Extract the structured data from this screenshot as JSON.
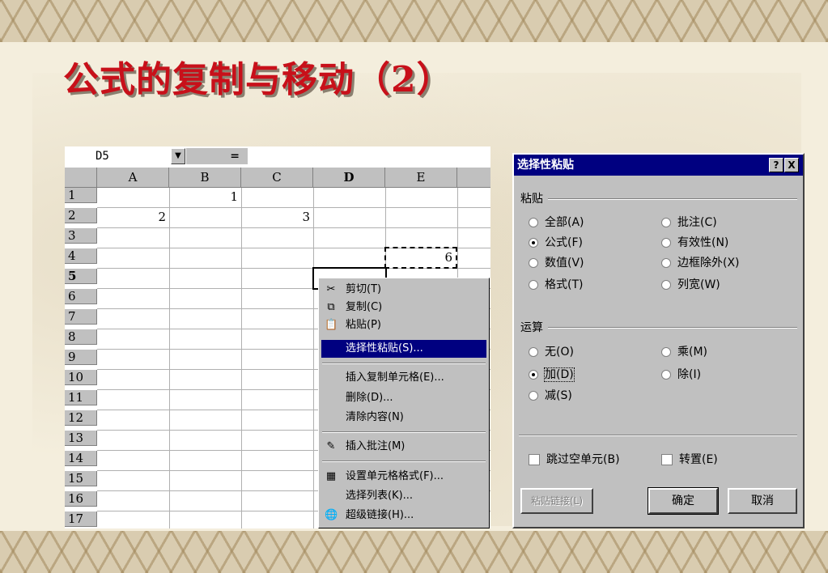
{
  "slide_title": "公式的复制与移动（2）",
  "spreadsheet": {
    "name_box": "D5",
    "name_box_arrow": "▼",
    "fx_label": "=",
    "columns": [
      "A",
      "B",
      "C",
      "D",
      "E"
    ],
    "rows": [
      "1",
      "2",
      "3",
      "4",
      "5",
      "6",
      "7",
      "8",
      "9",
      "10",
      "11",
      "12",
      "13",
      "14",
      "15",
      "16",
      "17"
    ],
    "cells": {
      "B1": "1",
      "A2": "2",
      "C2": "3",
      "E4": "6"
    }
  },
  "context_menu": {
    "items": [
      {
        "label": "剪切(T)",
        "icon": "scissors-icon"
      },
      {
        "label": "复制(C)",
        "icon": "copy-icon"
      },
      {
        "label": "粘贴(P)",
        "icon": "paste-icon"
      },
      {
        "label": "选择性粘贴(S)...",
        "selected": true
      },
      {
        "label": "插入复制单元格(E)..."
      },
      {
        "label": "删除(D)..."
      },
      {
        "label": "清除内容(N)"
      },
      {
        "label": "插入批注(M)",
        "icon": "comment-icon"
      },
      {
        "label": "设置单元格格式(F)...",
        "icon": "format-cells-icon"
      },
      {
        "label": "选择列表(K)..."
      },
      {
        "label": "超级链接(H)...",
        "icon": "hyperlink-icon"
      }
    ]
  },
  "dialog": {
    "title": "选择性粘贴",
    "help_button": "?",
    "close_button": "X",
    "paste_group": "粘贴",
    "paste_options": [
      {
        "label": "全部(A)",
        "checked": false
      },
      {
        "label": "批注(C)",
        "checked": false
      },
      {
        "label": "公式(F)",
        "checked": true
      },
      {
        "label": "有效性(N)",
        "checked": false
      },
      {
        "label": "数值(V)",
        "checked": false
      },
      {
        "label": "边框除外(X)",
        "checked": false
      },
      {
        "label": "格式(T)",
        "checked": false
      },
      {
        "label": "列宽(W)",
        "checked": false
      }
    ],
    "operation_group": "运算",
    "operation_options": [
      {
        "label": "无(O)",
        "checked": false
      },
      {
        "label": "乘(M)",
        "checked": false
      },
      {
        "label": "加(D)",
        "checked": true
      },
      {
        "label": "除(I)",
        "checked": false
      },
      {
        "label": "减(S)",
        "checked": false
      }
    ],
    "skip_blanks": "跳过空单元(B)",
    "transpose": "转置(E)",
    "paste_link_button": "粘贴链接(L)",
    "ok_button": "确定",
    "cancel_button": "取消"
  }
}
